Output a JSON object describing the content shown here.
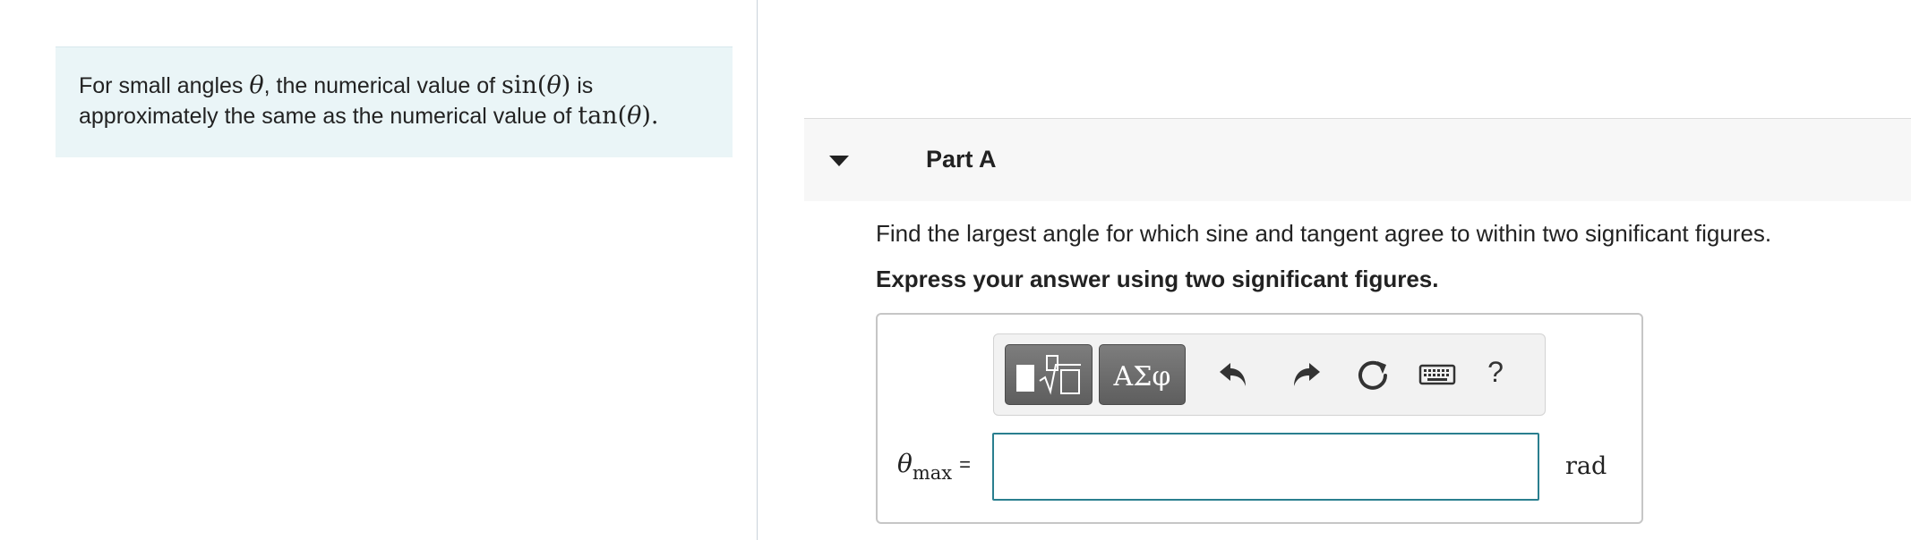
{
  "info": {
    "text_prefix": "For small angles ",
    "theta": "θ",
    "text_mid1": ", the numerical value of ",
    "sin_func": "sin(",
    "sin_close": ")",
    "text_mid2": " is",
    "text_line2": "approximately the same as the numerical value of ",
    "tan_func": "tan(",
    "tan_close": ").",
    "tan_theta": "θ"
  },
  "part": {
    "title": "Part A",
    "question": "Find the largest angle for which sine and tangent agree to within two significant figures.",
    "instruction": "Express your answer using two significant figures."
  },
  "toolbar": {
    "greek_label": "ΑΣφ",
    "help_label": "?",
    "icons": [
      "templates-icon",
      "greek-symbols-button",
      "undo-icon",
      "redo-icon",
      "reset-icon",
      "keyboard-icon",
      "help-icon"
    ]
  },
  "answer": {
    "var_symbol": "θ",
    "var_sub": "max",
    "equals": "=",
    "value": "",
    "unit": "rad"
  },
  "colors": {
    "info_bg": "#eaf5f7",
    "input_border": "#2a7f8f",
    "toolbar_btn": "#6e6e6e"
  }
}
